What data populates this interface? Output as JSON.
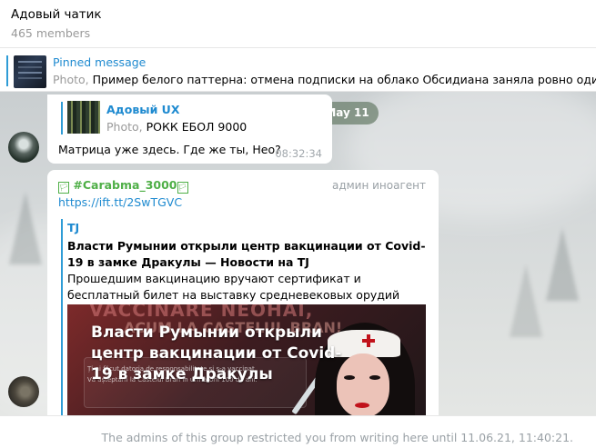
{
  "header": {
    "title": "Адовый чатик",
    "members": "465 members"
  },
  "pinned": {
    "title": "Pinned message",
    "photo_label": "Photo,",
    "text": "Пример белого паттерна: отмена подписки на облако Обсидиана заняла ровно один кл"
  },
  "chat": {
    "date": "May 11",
    "message1": {
      "quote_title": "Адовый UX",
      "quote_photo_label": "Photo,",
      "quote_text": "РОКК ЕБОЛ 9000",
      "text": "Матрица уже здесь. Где же ты, Нео?",
      "time": "08:32:34"
    },
    "message2": {
      "tag": "#Carabma_3000",
      "tag_glyph": "🏳",
      "author_badge": "админ иноагент",
      "link": "https://ift.tt/2SwTGVC",
      "preview": {
        "site": "TJ",
        "title": "Власти Румынии открыли центр вакцинации от Covid-19 в замке Дракулы — Новости на TJ",
        "description": "Прошедшим вакцинацию вручают сертификат и бесплатный билет на выставку средневековых орудий пыток.",
        "image_headline": "Власти Румынии открыли центр вакцинации от Covid-19 в замке Дракулы",
        "image_bg_line1": "VACCINARE NEOHAI,",
        "image_bg_line2": "ACUM LA CASTELUL BRAN!",
        "image_small1": "Ți-ai făcut datoria de responsabilitate și s-a vaccinat.",
        "image_small2": "Vă așteptăm la Castelul Bran în următorii 100 de ani."
      }
    }
  },
  "footer": {
    "text": "The admins of this group restricted you from writing here until 11.06.21, 11:40:21."
  },
  "colors": {
    "link": "#1e8ad0",
    "tag": "#4faf47",
    "date_pill": "#6c806e",
    "muted": "#9aa1a6"
  }
}
